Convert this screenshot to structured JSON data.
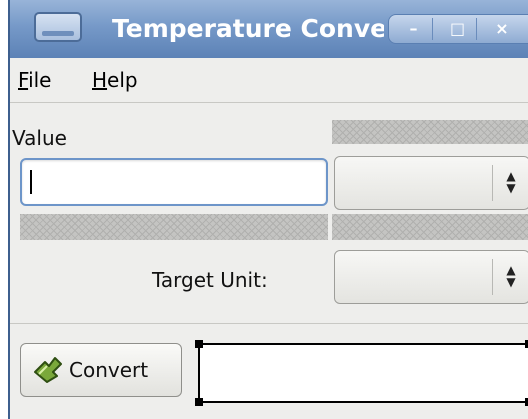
{
  "window": {
    "title": "Temperature Conve",
    "controls": {
      "minimize": "–",
      "maximize": "□",
      "close": "×"
    }
  },
  "menu": {
    "file_mnemonic": "F",
    "file_rest": "ile",
    "help_mnemonic": "H",
    "help_rest": "elp"
  },
  "form": {
    "value_label": "Value",
    "value_input": "",
    "source_unit_selected": "",
    "target_unit_label": "Target Unit:",
    "target_unit_selected": ""
  },
  "actions": {
    "convert_label": "Convert"
  },
  "result": {
    "text": ""
  },
  "icons": {
    "window_icon": "window-icon",
    "convert_icon": "convert-icon",
    "combo_arrows": "updown-arrows-icon"
  },
  "colors": {
    "titlebar": "#7699c8",
    "window_bg": "#eeeeec",
    "focus_border": "#6d95c9"
  }
}
